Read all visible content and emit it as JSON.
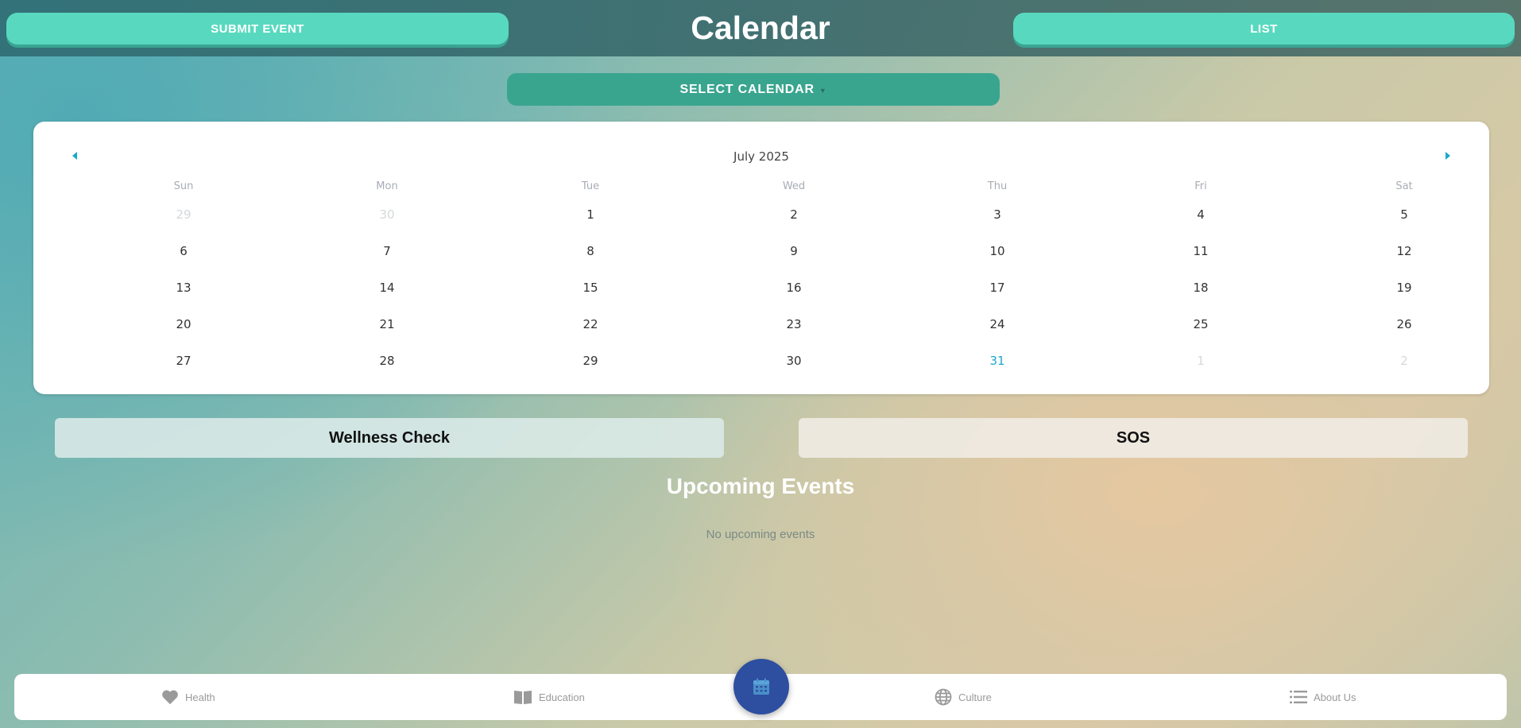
{
  "header": {
    "submit_label": "SUBMIT EVENT",
    "title": "Calendar",
    "list_label": "LIST"
  },
  "select_calendar": {
    "label": "SELECT CALENDAR"
  },
  "calendar": {
    "month_label": "July 2025",
    "weekdays": [
      "Sun",
      "Mon",
      "Tue",
      "Wed",
      "Thu",
      "Fri",
      "Sat"
    ],
    "weeks": [
      [
        "29",
        "30",
        "1",
        "2",
        "3",
        "4",
        "5"
      ],
      [
        "6",
        "7",
        "8",
        "9",
        "10",
        "11",
        "12"
      ],
      [
        "13",
        "14",
        "15",
        "16",
        "17",
        "18",
        "19"
      ],
      [
        "20",
        "21",
        "22",
        "23",
        "24",
        "25",
        "26"
      ],
      [
        "27",
        "28",
        "29",
        "30",
        "31",
        "1",
        "2"
      ]
    ],
    "today": "31",
    "accent_color": "#1ca7c9"
  },
  "actions": {
    "wellness_label": "Wellness Check",
    "sos_label": "SOS"
  },
  "upcoming": {
    "title": "Upcoming Events",
    "empty_text": "No upcoming events"
  },
  "bottom_nav": {
    "items": [
      {
        "label": "Health",
        "icon": "heart-icon"
      },
      {
        "label": "Education",
        "icon": "book-icon"
      },
      {
        "label": "Culture",
        "icon": "globe-icon"
      },
      {
        "label": "About Us",
        "icon": "list-icon"
      }
    ],
    "fab_icon": "calendar-icon"
  },
  "colors": {
    "header_button": "#58d9bf",
    "select_button": "#3aa58f",
    "fab": "#2e4fa0"
  }
}
